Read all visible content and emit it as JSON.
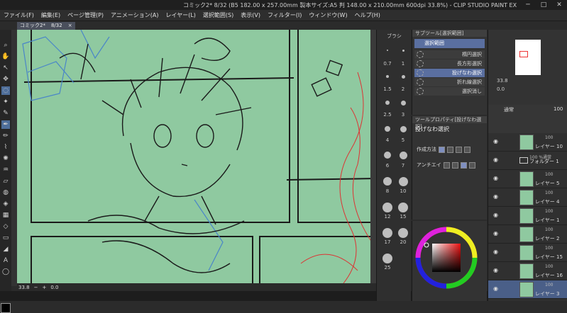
{
  "window": {
    "title": "コミック2* 8/32 (B5 182.00 x 257.00mm 製本サイズ:A5 判 148.00 x 210.00mm 600dpi 33.8%) - CLIP STUDIO PAINT EX",
    "minimize": "─",
    "maximize": "□",
    "close": "✕"
  },
  "menu": [
    "ファイル(F)",
    "編集(E)",
    "ページ管理(P)",
    "アニメーション(A)",
    "レイヤー(L)",
    "選択範囲(S)",
    "表示(V)",
    "フィルター(I)",
    "ウィンドウ(W)",
    "ヘルプ(H)"
  ],
  "document_tab": {
    "name": "コミック2*",
    "page": "8/32",
    "close": "×"
  },
  "status": {
    "zoom": "33.8",
    "angle": "0.0"
  },
  "brush_panel": {
    "title": "ブラシ",
    "sizes": [
      "0.7",
      "1",
      "1.5",
      "2",
      "2.5",
      "3",
      "4",
      "5",
      "6",
      "7",
      "8",
      "10",
      "12",
      "15",
      "17",
      "20",
      "25"
    ]
  },
  "subtool": {
    "panel_title": "サブツール[選択範囲]",
    "group": "選択範囲",
    "items": [
      {
        "label": "楕円選択",
        "active": false
      },
      {
        "label": "長方形選択",
        "active": false
      },
      {
        "label": "投げなわ選択",
        "active": true
      },
      {
        "label": "折れ線選択",
        "active": false
      },
      {
        "label": "選択消し",
        "active": false
      }
    ]
  },
  "tool_property": {
    "panel_title": "ツールプロパティ[投げなわ選択]",
    "tool_name": "投げなわ選択",
    "creation_method_label": "作成方法",
    "antialias_label": "アンチエイ"
  },
  "navigator": {
    "zoom": "33.8",
    "angle": "0.0"
  },
  "layers": {
    "blend_mode": "通常",
    "opacity": "100",
    "rows": [
      {
        "pct": "100",
        "name": "レイヤー 10",
        "selected": false,
        "folder": false
      },
      {
        "pct": "100 %通常",
        "name": "フォルダー 1",
        "selected": false,
        "folder": true
      },
      {
        "pct": "100",
        "name": "レイヤー 5",
        "selected": false,
        "folder": false
      },
      {
        "pct": "100",
        "name": "レイヤー 4",
        "selected": false,
        "folder": false
      },
      {
        "pct": "100",
        "name": "レイヤー 1",
        "selected": false,
        "folder": false
      },
      {
        "pct": "100",
        "name": "レイヤー 2",
        "selected": false,
        "folder": false
      },
      {
        "pct": "100",
        "name": "レイヤー 15",
        "selected": false,
        "folder": false
      },
      {
        "pct": "100",
        "name": "レイヤー 16",
        "selected": false,
        "folder": false
      },
      {
        "pct": "100",
        "name": "レイヤー 3",
        "selected": true,
        "folder": false
      }
    ]
  },
  "colors": {
    "canvas_bg": "#8fc9a0",
    "accent": "#5a6fa0",
    "sketch_black": "#1a1a1a",
    "sketch_blue": "#4a86c8",
    "sketch_red": "#d33"
  }
}
